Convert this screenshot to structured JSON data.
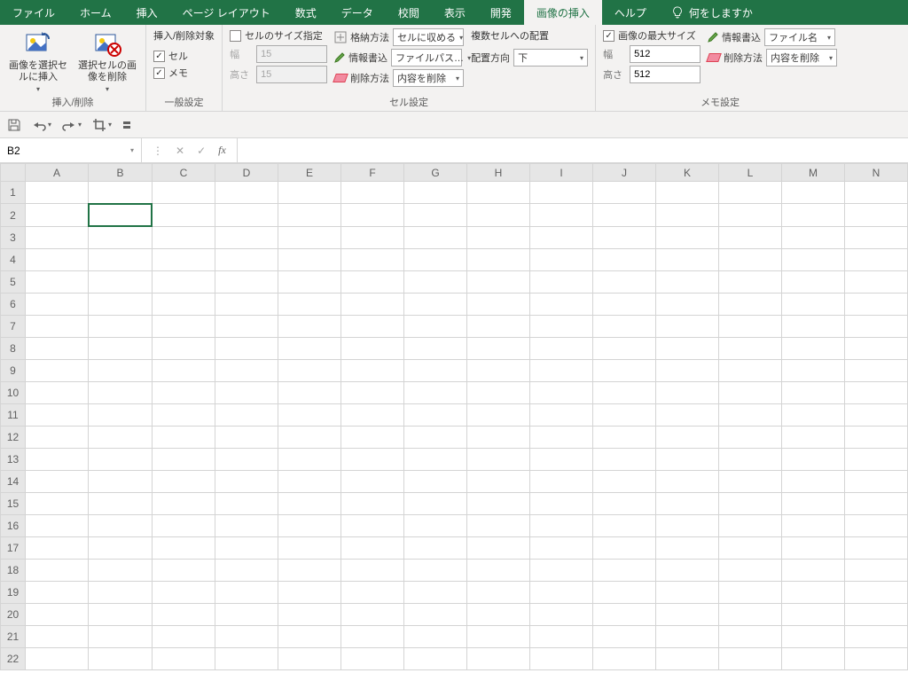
{
  "tabs": {
    "items": [
      "ファイル",
      "ホーム",
      "挿入",
      "ページ レイアウト",
      "数式",
      "データ",
      "校閲",
      "表示",
      "開発",
      "画像の挿入",
      "ヘルプ"
    ],
    "active": 9,
    "tell_me": "何をしますか"
  },
  "ribbon": {
    "group_insdel": {
      "title": "挿入/削除",
      "btn_insert": "画像を選択セルに挿入",
      "btn_delete": "選択セルの画像を削除"
    },
    "group_general": {
      "title": "一般設定",
      "heading": "挿入/削除対象",
      "chk_cell": "セル",
      "chk_memo": "メモ"
    },
    "group_cell": {
      "title": "セル設定",
      "size_spec": "セルのサイズ指定",
      "width_label": "幅",
      "width_value": "15",
      "height_label": "高さ",
      "height_value": "15",
      "fit_label": "格納方法",
      "fit_value": "セルに収める",
      "info_label": "情報書込",
      "info_value": "ファイルパス…",
      "del_label": "削除方法",
      "del_value": "内容を削除",
      "multi_heading": "複数セルへの配置",
      "dir_label": "配置方向",
      "dir_value": "下"
    },
    "group_memo": {
      "title": "メモ設定",
      "max_size": "画像の最大サイズ",
      "width_label": "幅",
      "width_value": "512",
      "height_label": "高さ",
      "height_value": "512",
      "info_label": "情報書込",
      "info_value": "ファイル名",
      "del_label": "削除方法",
      "del_value": "内容を削除"
    }
  },
  "namebox": "B2",
  "columns": [
    "A",
    "B",
    "C",
    "D",
    "E",
    "F",
    "G",
    "H",
    "I",
    "J",
    "K",
    "L",
    "M",
    "N"
  ],
  "rows": 22,
  "selected": {
    "r": 2,
    "c": 2
  }
}
